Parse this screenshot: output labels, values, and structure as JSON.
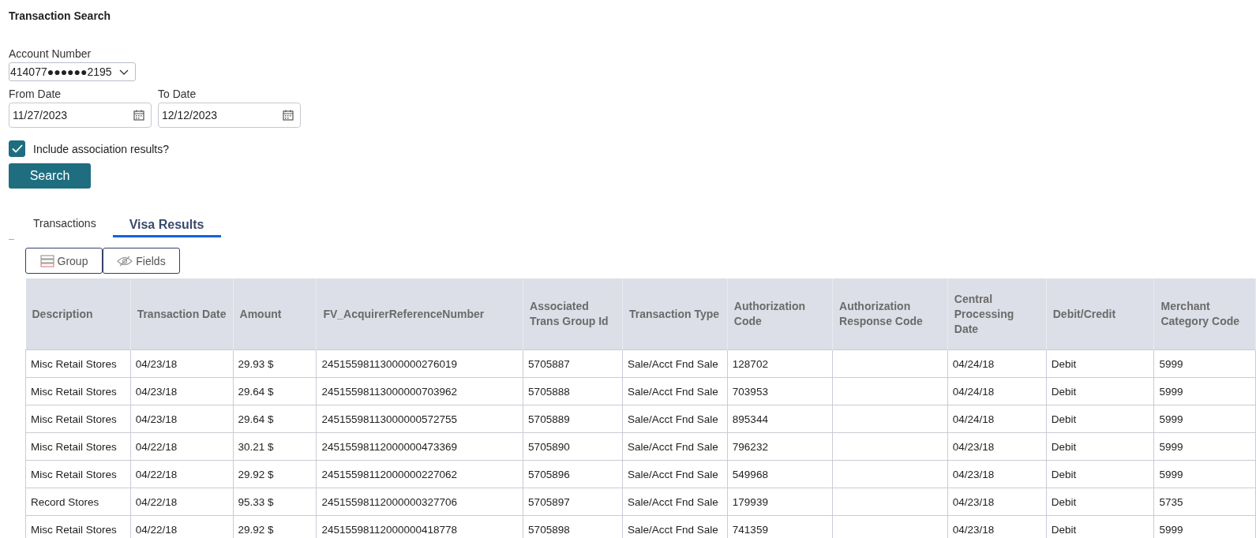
{
  "title": "Transaction Search",
  "account": {
    "label": "Account Number",
    "value": "414077●●●●●●2195"
  },
  "from_date": {
    "label": "From Date",
    "value": "11/27/2023"
  },
  "to_date": {
    "label": "To Date",
    "value": "12/12/2023"
  },
  "include_association": {
    "label": "Include association results?",
    "checked": true
  },
  "search_button": "Search",
  "tabs": [
    {
      "label": "Transactions",
      "selected": false
    },
    {
      "label": "Visa Results",
      "selected": true
    }
  ],
  "toolbar": [
    {
      "label": "Group",
      "kind": "group"
    },
    {
      "label": "Fields",
      "kind": "fields"
    }
  ],
  "table": {
    "columns": [
      "Description",
      "Transaction Date",
      "Amount",
      "FV_AcquirerReferenceNumber",
      "Associated Trans Group Id",
      "Transaction Type",
      "Authorization Code",
      "Authorization Response Code",
      "Central Processing Date",
      "Debit/Credit",
      "Merchant Category Code"
    ],
    "rows": [
      [
        "Misc Retail Stores",
        "04/23/18",
        "29.93 $",
        "24515598113000000276019",
        "5705887",
        "Sale/Acct Fnd Sale",
        "128702",
        "",
        "04/24/18",
        "Debit",
        "5999"
      ],
      [
        "Misc Retail Stores",
        "04/23/18",
        "29.64 $",
        "24515598113000000703962",
        "5705888",
        "Sale/Acct Fnd Sale",
        "703953",
        "",
        "04/24/18",
        "Debit",
        "5999"
      ],
      [
        "Misc Retail Stores",
        "04/23/18",
        "29.64 $",
        "24515598113000000572755",
        "5705889",
        "Sale/Acct Fnd Sale",
        "895344",
        "",
        "04/24/18",
        "Debit",
        "5999"
      ],
      [
        "Misc Retail Stores",
        "04/22/18",
        "30.21 $",
        "24515598112000000473369",
        "5705890",
        "Sale/Acct Fnd Sale",
        "796232",
        "",
        "04/23/18",
        "Debit",
        "5999"
      ],
      [
        "Misc Retail Stores",
        "04/22/18",
        "29.92 $",
        "24515598112000000227062",
        "5705896",
        "Sale/Acct Fnd Sale",
        "549968",
        "",
        "04/23/18",
        "Debit",
        "5999"
      ],
      [
        "Record Stores",
        "04/22/18",
        "95.33 $",
        "24515598112000000327706",
        "5705897",
        "Sale/Acct Fnd Sale",
        "179939",
        "",
        "04/23/18",
        "Debit",
        "5735"
      ],
      [
        "Misc Retail Stores",
        "04/22/18",
        "29.92 $",
        "24515598112000000418778",
        "5705898",
        "Sale/Acct Fnd Sale",
        "741359",
        "",
        "04/23/18",
        "Debit",
        "5999"
      ]
    ]
  }
}
